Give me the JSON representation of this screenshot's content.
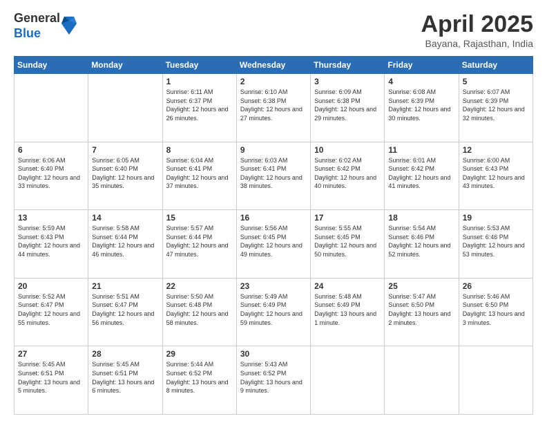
{
  "logo": {
    "general": "General",
    "blue": "Blue"
  },
  "header": {
    "month": "April 2025",
    "location": "Bayana, Rajasthan, India"
  },
  "weekdays": [
    "Sunday",
    "Monday",
    "Tuesday",
    "Wednesday",
    "Thursday",
    "Friday",
    "Saturday"
  ],
  "weeks": [
    [
      {
        "day": "",
        "sunrise": "",
        "sunset": "",
        "daylight": ""
      },
      {
        "day": "",
        "sunrise": "",
        "sunset": "",
        "daylight": ""
      },
      {
        "day": "1",
        "sunrise": "Sunrise: 6:11 AM",
        "sunset": "Sunset: 6:37 PM",
        "daylight": "Daylight: 12 hours and 26 minutes."
      },
      {
        "day": "2",
        "sunrise": "Sunrise: 6:10 AM",
        "sunset": "Sunset: 6:38 PM",
        "daylight": "Daylight: 12 hours and 27 minutes."
      },
      {
        "day": "3",
        "sunrise": "Sunrise: 6:09 AM",
        "sunset": "Sunset: 6:38 PM",
        "daylight": "Daylight: 12 hours and 29 minutes."
      },
      {
        "day": "4",
        "sunrise": "Sunrise: 6:08 AM",
        "sunset": "Sunset: 6:39 PM",
        "daylight": "Daylight: 12 hours and 30 minutes."
      },
      {
        "day": "5",
        "sunrise": "Sunrise: 6:07 AM",
        "sunset": "Sunset: 6:39 PM",
        "daylight": "Daylight: 12 hours and 32 minutes."
      }
    ],
    [
      {
        "day": "6",
        "sunrise": "Sunrise: 6:06 AM",
        "sunset": "Sunset: 6:40 PM",
        "daylight": "Daylight: 12 hours and 33 minutes."
      },
      {
        "day": "7",
        "sunrise": "Sunrise: 6:05 AM",
        "sunset": "Sunset: 6:40 PM",
        "daylight": "Daylight: 12 hours and 35 minutes."
      },
      {
        "day": "8",
        "sunrise": "Sunrise: 6:04 AM",
        "sunset": "Sunset: 6:41 PM",
        "daylight": "Daylight: 12 hours and 37 minutes."
      },
      {
        "day": "9",
        "sunrise": "Sunrise: 6:03 AM",
        "sunset": "Sunset: 6:41 PM",
        "daylight": "Daylight: 12 hours and 38 minutes."
      },
      {
        "day": "10",
        "sunrise": "Sunrise: 6:02 AM",
        "sunset": "Sunset: 6:42 PM",
        "daylight": "Daylight: 12 hours and 40 minutes."
      },
      {
        "day": "11",
        "sunrise": "Sunrise: 6:01 AM",
        "sunset": "Sunset: 6:42 PM",
        "daylight": "Daylight: 12 hours and 41 minutes."
      },
      {
        "day": "12",
        "sunrise": "Sunrise: 6:00 AM",
        "sunset": "Sunset: 6:43 PM",
        "daylight": "Daylight: 12 hours and 43 minutes."
      }
    ],
    [
      {
        "day": "13",
        "sunrise": "Sunrise: 5:59 AM",
        "sunset": "Sunset: 6:43 PM",
        "daylight": "Daylight: 12 hours and 44 minutes."
      },
      {
        "day": "14",
        "sunrise": "Sunrise: 5:58 AM",
        "sunset": "Sunset: 6:44 PM",
        "daylight": "Daylight: 12 hours and 46 minutes."
      },
      {
        "day": "15",
        "sunrise": "Sunrise: 5:57 AM",
        "sunset": "Sunset: 6:44 PM",
        "daylight": "Daylight: 12 hours and 47 minutes."
      },
      {
        "day": "16",
        "sunrise": "Sunrise: 5:56 AM",
        "sunset": "Sunset: 6:45 PM",
        "daylight": "Daylight: 12 hours and 49 minutes."
      },
      {
        "day": "17",
        "sunrise": "Sunrise: 5:55 AM",
        "sunset": "Sunset: 6:45 PM",
        "daylight": "Daylight: 12 hours and 50 minutes."
      },
      {
        "day": "18",
        "sunrise": "Sunrise: 5:54 AM",
        "sunset": "Sunset: 6:46 PM",
        "daylight": "Daylight: 12 hours and 52 minutes."
      },
      {
        "day": "19",
        "sunrise": "Sunrise: 5:53 AM",
        "sunset": "Sunset: 6:46 PM",
        "daylight": "Daylight: 12 hours and 53 minutes."
      }
    ],
    [
      {
        "day": "20",
        "sunrise": "Sunrise: 5:52 AM",
        "sunset": "Sunset: 6:47 PM",
        "daylight": "Daylight: 12 hours and 55 minutes."
      },
      {
        "day": "21",
        "sunrise": "Sunrise: 5:51 AM",
        "sunset": "Sunset: 6:47 PM",
        "daylight": "Daylight: 12 hours and 56 minutes."
      },
      {
        "day": "22",
        "sunrise": "Sunrise: 5:50 AM",
        "sunset": "Sunset: 6:48 PM",
        "daylight": "Daylight: 12 hours and 58 minutes."
      },
      {
        "day": "23",
        "sunrise": "Sunrise: 5:49 AM",
        "sunset": "Sunset: 6:49 PM",
        "daylight": "Daylight: 12 hours and 59 minutes."
      },
      {
        "day": "24",
        "sunrise": "Sunrise: 5:48 AM",
        "sunset": "Sunset: 6:49 PM",
        "daylight": "Daylight: 13 hours and 1 minute."
      },
      {
        "day": "25",
        "sunrise": "Sunrise: 5:47 AM",
        "sunset": "Sunset: 6:50 PM",
        "daylight": "Daylight: 13 hours and 2 minutes."
      },
      {
        "day": "26",
        "sunrise": "Sunrise: 5:46 AM",
        "sunset": "Sunset: 6:50 PM",
        "daylight": "Daylight: 13 hours and 3 minutes."
      }
    ],
    [
      {
        "day": "27",
        "sunrise": "Sunrise: 5:45 AM",
        "sunset": "Sunset: 6:51 PM",
        "daylight": "Daylight: 13 hours and 5 minutes."
      },
      {
        "day": "28",
        "sunrise": "Sunrise: 5:45 AM",
        "sunset": "Sunset: 6:51 PM",
        "daylight": "Daylight: 13 hours and 6 minutes."
      },
      {
        "day": "29",
        "sunrise": "Sunrise: 5:44 AM",
        "sunset": "Sunset: 6:52 PM",
        "daylight": "Daylight: 13 hours and 8 minutes."
      },
      {
        "day": "30",
        "sunrise": "Sunrise: 5:43 AM",
        "sunset": "Sunset: 6:52 PM",
        "daylight": "Daylight: 13 hours and 9 minutes."
      },
      {
        "day": "",
        "sunrise": "",
        "sunset": "",
        "daylight": ""
      },
      {
        "day": "",
        "sunrise": "",
        "sunset": "",
        "daylight": ""
      },
      {
        "day": "",
        "sunrise": "",
        "sunset": "",
        "daylight": ""
      }
    ]
  ]
}
